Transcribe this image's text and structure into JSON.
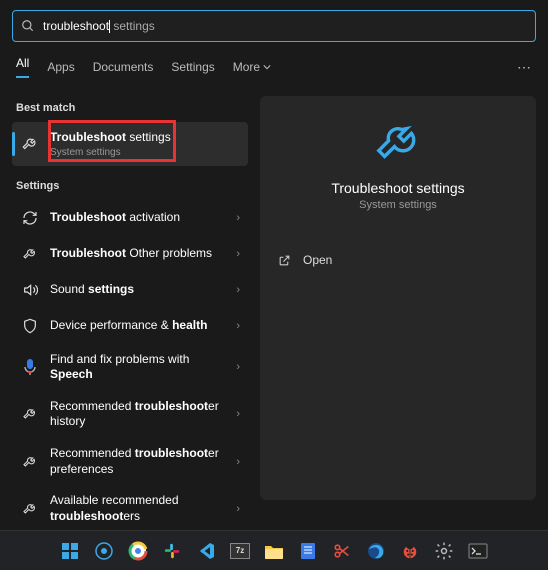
{
  "search": {
    "query": "troubleshoot",
    "suffix": " settings"
  },
  "tabs": {
    "all": "All",
    "apps": "Apps",
    "documents": "Documents",
    "settings": "Settings",
    "more": "More"
  },
  "sections": {
    "best_match": "Best match",
    "settings": "Settings"
  },
  "best": {
    "title_bold": "Troubleshoot",
    "title_rest": " settings",
    "subtitle": "System settings"
  },
  "items": [
    {
      "icon": "refresh",
      "bold": "Troubleshoot",
      "rest": " activation"
    },
    {
      "icon": "wrench",
      "bold": "Troubleshoot",
      "rest": " Other problems"
    },
    {
      "icon": "sound",
      "pre": "Sound ",
      "bold": "settings",
      "rest": ""
    },
    {
      "icon": "shield",
      "pre": "Device performance & ",
      "bold": "health",
      "rest": ""
    },
    {
      "icon": "mic",
      "pre": "Find and fix problems with ",
      "bold": "Speech",
      "rest": ""
    },
    {
      "icon": "wrench-rec",
      "pre": "Recommended ",
      "bold": "troubleshoot",
      "rest": "er history"
    },
    {
      "icon": "wrench-rec",
      "pre": "Recommended ",
      "bold": "troubleshoot",
      "rest": "er preferences"
    },
    {
      "icon": "wrench-rec",
      "pre": "Available recommended ",
      "bold": "troubleshoot",
      "rest": "ers"
    }
  ],
  "panel": {
    "title": "Troubleshoot settings",
    "subtitle": "System settings",
    "open": "Open"
  },
  "taskbar": {
    "items": [
      "start",
      "copilot",
      "chrome",
      "slack",
      "vscode",
      "7z",
      "explorer",
      "notes",
      "scissors",
      "firefox-dev",
      "ladybug",
      "gear",
      "terminal"
    ]
  }
}
